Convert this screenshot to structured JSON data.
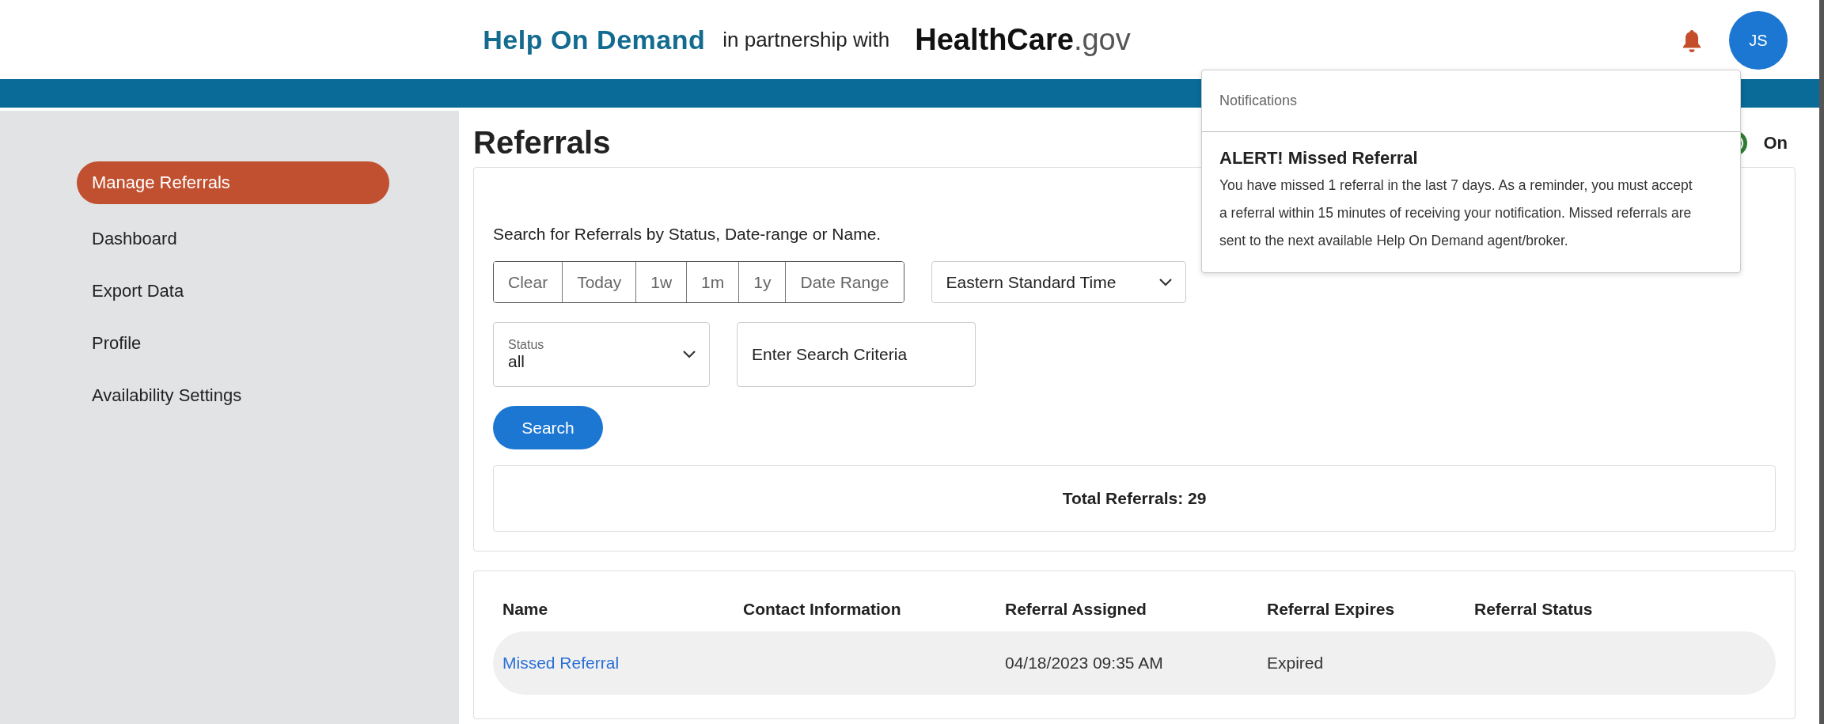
{
  "header": {
    "brand": "Help On Demand",
    "partnership": "in partnership with",
    "partner_logo": {
      "main": "HealthCare",
      "suffix": ".gov"
    },
    "avatar": "JS"
  },
  "sidebar": {
    "items": [
      {
        "label": "Manage Referrals",
        "selected": true
      },
      {
        "label": "Dashboard",
        "selected": false
      },
      {
        "label": "Export Data",
        "selected": false
      },
      {
        "label": "Profile",
        "selected": false
      },
      {
        "label": "Availability Settings",
        "selected": false
      }
    ]
  },
  "page": {
    "title": "Referrals",
    "availability_toggle": {
      "on": true,
      "label": "On"
    }
  },
  "search": {
    "instructions": "Search for Referrals by Status, Date-range or Name.",
    "ranges": [
      {
        "label": "Clear",
        "selected": false
      },
      {
        "label": "Today",
        "selected": false
      },
      {
        "label": "1w",
        "selected": false
      },
      {
        "label": "1m",
        "selected": false
      },
      {
        "label": "1y",
        "selected": false
      },
      {
        "label": "Date Range",
        "selected": false
      }
    ],
    "timezone": "Eastern Standard Time",
    "status": {
      "label": "Status",
      "value": "all"
    },
    "criteria": {
      "placeholder": "Enter Search Criteria"
    },
    "button": "Search",
    "total": "Total Referrals: 29"
  },
  "table": {
    "columns": [
      "Name",
      "Contact Information",
      "Referral Assigned",
      "Referral Expires",
      "Referral Status"
    ],
    "rows": [
      {
        "name": "Missed Referral",
        "contact": "",
        "assigned": "04/18/2023 09:35 AM",
        "expires": "Expired",
        "status": ""
      }
    ]
  },
  "notifications": {
    "title": "Notifications",
    "items": [
      {
        "title": "ALERT! Missed Referral",
        "body": "You have missed 1 referral in the last 7 days. As a reminder, you must accept a referral within 15 minutes of receiving your notification. Missed referrals are sent to the next available Help On Demand agent/broker."
      }
    ]
  }
}
